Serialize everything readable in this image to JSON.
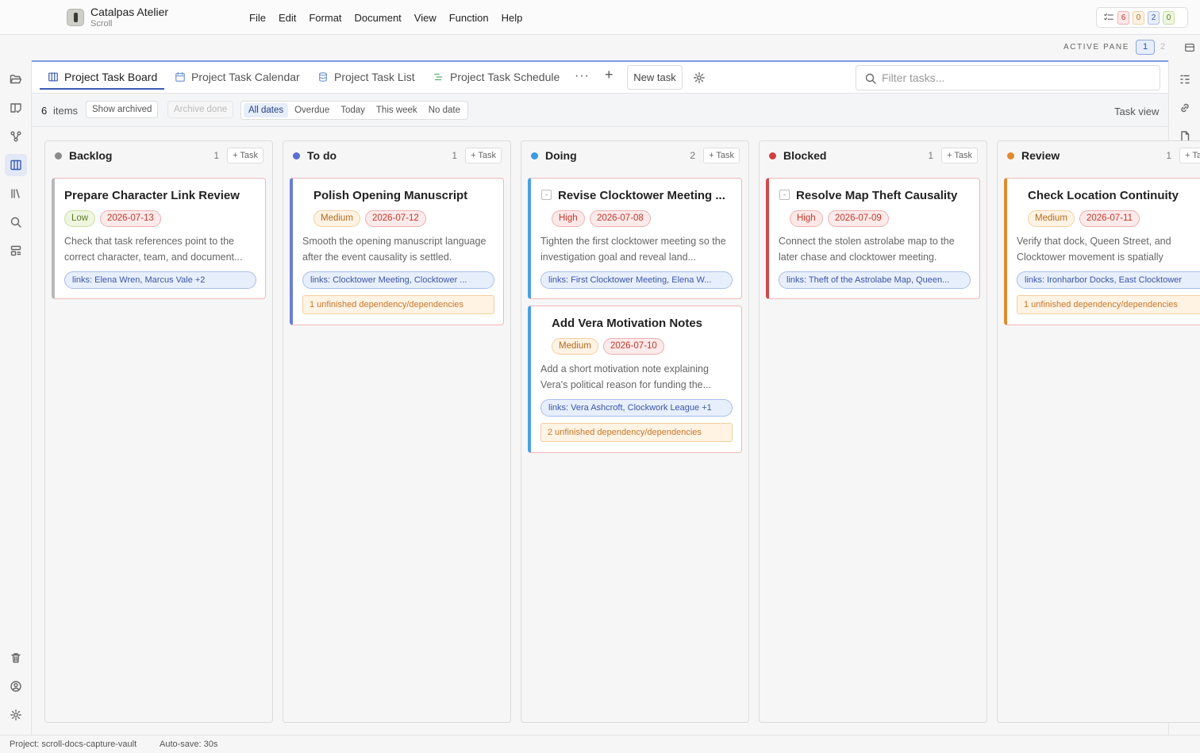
{
  "app": {
    "name": "Catalpas Atelier",
    "subtitle": "Scroll"
  },
  "menu": [
    "File",
    "Edit",
    "Format",
    "Document",
    "View",
    "Function",
    "Help"
  ],
  "issue_counter": {
    "icon": "checklist-icon",
    "values": [
      "6",
      "0",
      "2",
      "0"
    ]
  },
  "pane": {
    "label": "ACTIVE PANE",
    "active": "1",
    "other": "2"
  },
  "tabs": [
    {
      "label": "Project Task Board",
      "icon": "board-icon",
      "active": true
    },
    {
      "label": "Project Task Calendar",
      "icon": "calendar-icon"
    },
    {
      "label": "Project Task List",
      "icon": "database-icon"
    },
    {
      "label": "Project Task Schedule",
      "icon": "gantt-icon"
    }
  ],
  "tab_more": "···",
  "tab_add": "+",
  "new_task": "New task",
  "filter": {
    "placeholder": "Filter tasks..."
  },
  "toolbar": {
    "count": "6",
    "count_label": "items",
    "show_archived": "Show archived",
    "archive_done": "Archive done",
    "date_filters": [
      "All dates",
      "Overdue",
      "Today",
      "This week",
      "No date"
    ],
    "active_date_filter": "All dates",
    "view_label": "Task view"
  },
  "columns": [
    {
      "name": "Backlog",
      "count": "1",
      "add_label": "+ Task",
      "dot_color": "#8a8a8a",
      "cards": [
        {
          "title": "Prepare Character Link Review",
          "priority": "Low",
          "priority_level": "low",
          "due": "2026-07-13",
          "collapsible": false,
          "desc": "Check that task references point to the correct character, team, and document...",
          "links": "links: Elena Wren, Marcus Vale +2",
          "deps": "",
          "accent": "#b9b9b9"
        }
      ]
    },
    {
      "name": "To do",
      "count": "1",
      "add_label": "+ Task",
      "dot_color": "#5a6fd0",
      "cards": [
        {
          "title": "Polish Opening Manuscript",
          "priority": "Medium",
          "priority_level": "medium",
          "due": "2026-07-12",
          "collapsible": false,
          "desc": "Smooth the opening manuscript language after the event causality is settled.",
          "links": "links: Clocktower Meeting, Clocktower ...",
          "deps": "1 unfinished dependency/dependencies",
          "accent": "#6a7ed6"
        }
      ]
    },
    {
      "name": "Doing",
      "count": "2",
      "add_label": "+ Task",
      "dot_color": "#3b9be0",
      "cards": [
        {
          "title": "Revise Clocktower Meeting ...",
          "priority": "High",
          "priority_level": "high",
          "due": "2026-07-08",
          "collapsible": true,
          "desc": "Tighten the first clocktower meeting so the investigation goal and reveal land...",
          "links": "links: First Clocktower Meeting, Elena W...",
          "deps": "",
          "accent": "#4aa0e2"
        },
        {
          "title": "Add Vera Motivation Notes",
          "priority": "Medium",
          "priority_level": "medium",
          "due": "2026-07-10",
          "collapsible": false,
          "desc": "Add a short motivation note explaining Vera's political reason for funding the...",
          "links": "links: Vera Ashcroft, Clockwork League +1",
          "deps": "2 unfinished dependency/dependencies",
          "accent": "#4aa0e2"
        }
      ]
    },
    {
      "name": "Blocked",
      "count": "1",
      "add_label": "+ Task",
      "dot_color": "#d04040",
      "cards": [
        {
          "title": "Resolve Map Theft Causality",
          "priority": "High",
          "priority_level": "high",
          "due": "2026-07-09",
          "collapsible": true,
          "desc": "Connect the stolen astrolabe map to the later chase and clocktower meeting.",
          "links": "links: Theft of the Astrolabe Map, Queen...",
          "deps": "",
          "accent": "#d04a4a"
        }
      ]
    },
    {
      "name": "Review",
      "count": "1",
      "add_label": "+ Task",
      "dot_color": "#e08a30",
      "cards": [
        {
          "title": "Check Location Continuity",
          "priority": "Medium",
          "priority_level": "medium",
          "due": "2026-07-11",
          "collapsible": false,
          "desc": "Verify that dock, Queen Street, and Clocktower movement is spatially consistent.",
          "links": "links: Ironharbor Docks, East Clocktower",
          "deps": "1 unfinished dependency/dependencies",
          "accent": "#e08a30"
        }
      ]
    }
  ],
  "status": {
    "project": "Project: scroll-docs-capture-vault",
    "autosave": "Auto-save: 30s"
  }
}
